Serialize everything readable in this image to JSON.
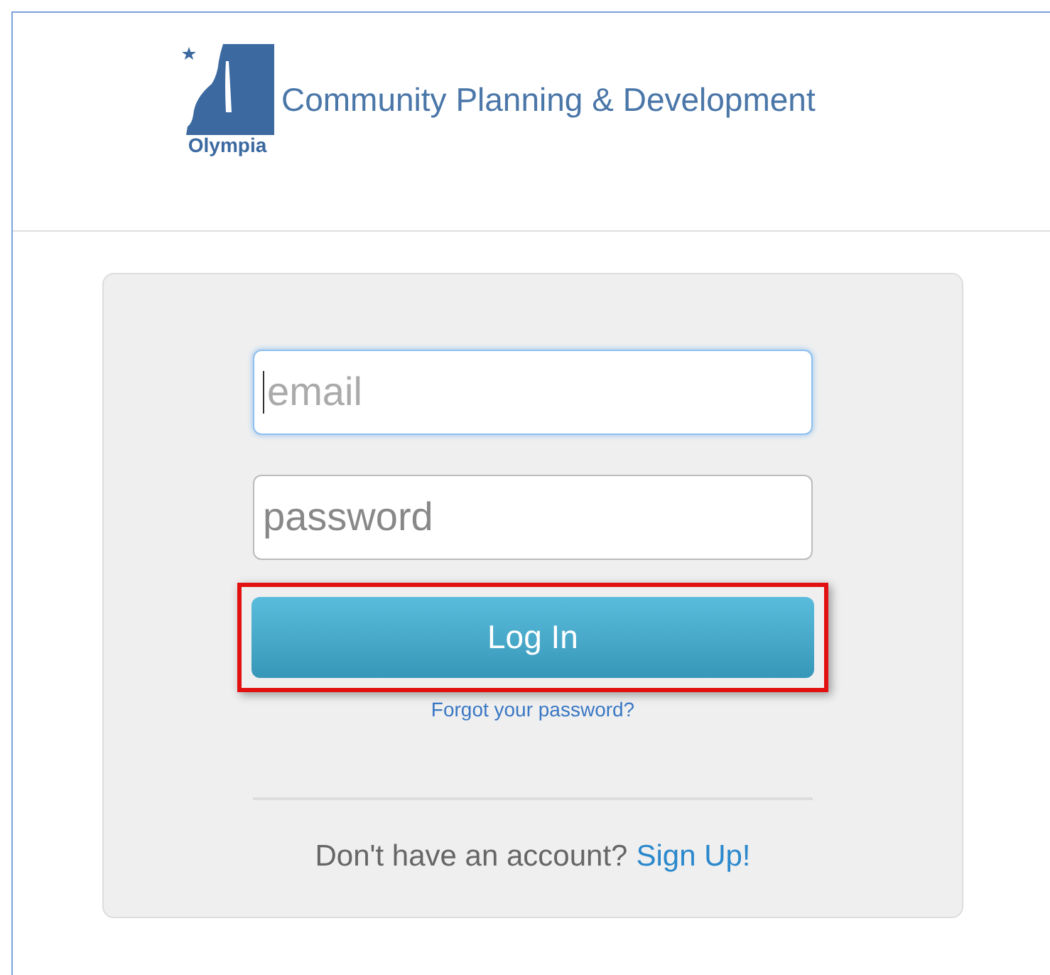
{
  "header": {
    "logo_text": "Olympia",
    "title": "Community Planning & Development"
  },
  "login_form": {
    "fields": [
      {
        "placeholder": "email",
        "focused": true
      },
      {
        "placeholder": "password",
        "focused": false
      }
    ],
    "login_button": {
      "label": "Log In",
      "highlighted": true
    },
    "forgot_link": "Forgot your password?",
    "signup_prompt": "Don't have an account?",
    "signup_link": "Sign Up!"
  }
}
